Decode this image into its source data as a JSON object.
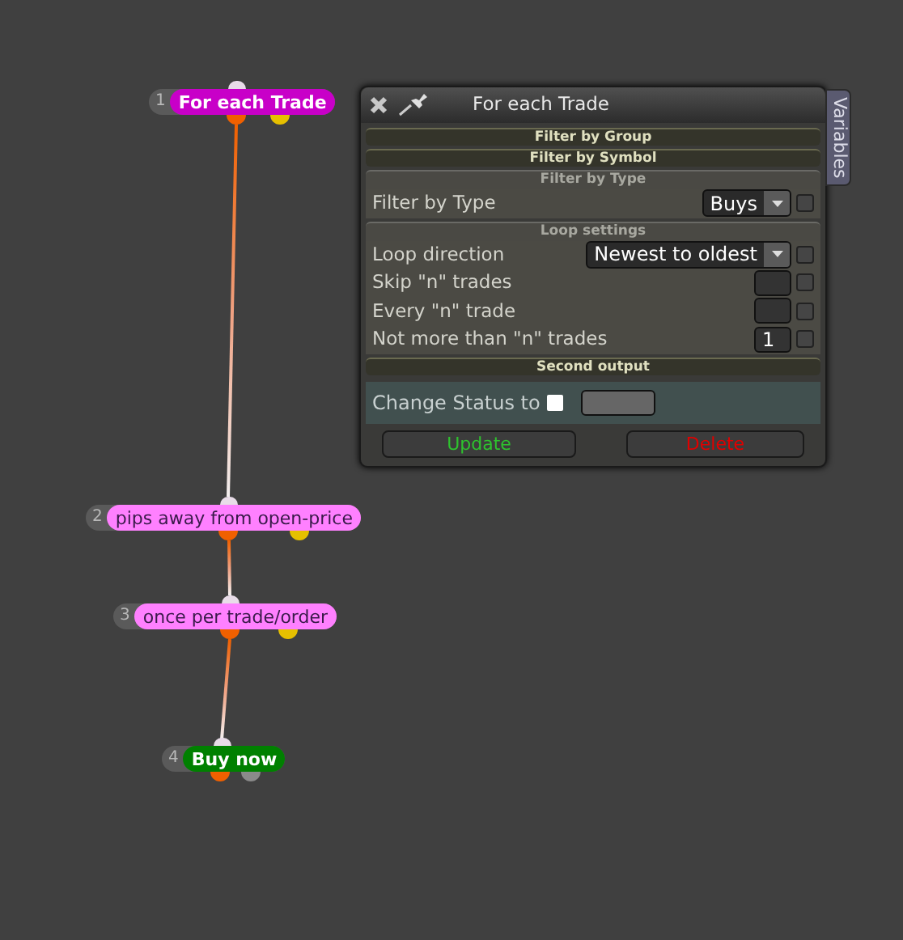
{
  "nodes": [
    {
      "number": "1",
      "label": "For each Trade",
      "kind": "loop"
    },
    {
      "number": "2",
      "label": "pips away from open-price",
      "kind": "condition"
    },
    {
      "number": "3",
      "label": "once per trade/order",
      "kind": "condition"
    },
    {
      "number": "4",
      "label": "Buy now",
      "kind": "action"
    }
  ],
  "panel": {
    "title": "For each Trade",
    "side_tab": "Variables",
    "sections": [
      {
        "kind": "group",
        "title": "Filter by Group"
      },
      {
        "kind": "group",
        "title": "Filter by Symbol"
      },
      {
        "kind": "section",
        "title": "Filter by Type",
        "rows": [
          {
            "kind": "select",
            "label": "Filter by Type",
            "value": "Buys",
            "checked": false
          }
        ]
      },
      {
        "kind": "section",
        "title": "Loop settings",
        "rows": [
          {
            "kind": "select",
            "label": "Loop direction",
            "value": "Newest to oldest",
            "checked": false
          },
          {
            "kind": "number",
            "label": "Skip \"n\" trades",
            "checked": false
          },
          {
            "kind": "number",
            "label": "Every \"n\" trade",
            "checked": false
          },
          {
            "kind": "number",
            "label": "Not more than \"n\" trades",
            "value": "1",
            "checked": false
          }
        ]
      },
      {
        "kind": "group",
        "title": "Second output"
      }
    ],
    "status": {
      "label": "Change Status to",
      "checked": false
    },
    "buttons": [
      {
        "label": "Update",
        "color": "#2ec22e"
      },
      {
        "label": "Delete",
        "color": "#e00000"
      }
    ]
  }
}
